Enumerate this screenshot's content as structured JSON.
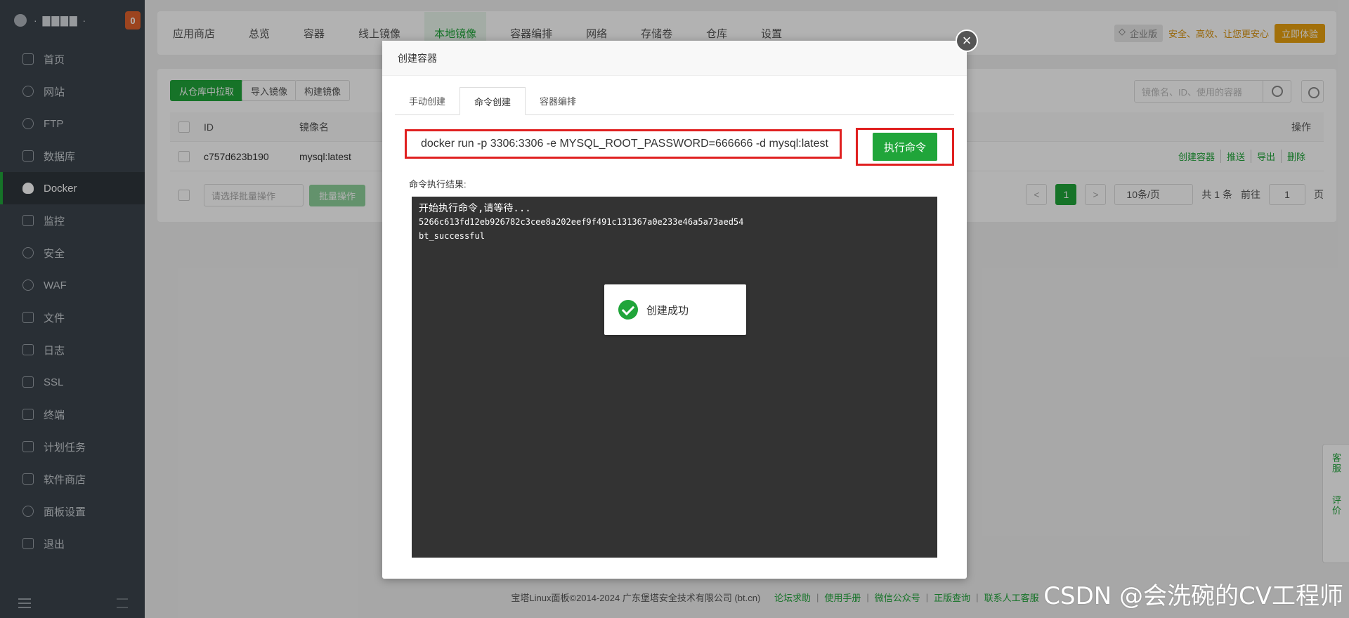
{
  "sidebar": {
    "brand_name": "·  ▇▇▇▇  ·",
    "badge": "0",
    "items": [
      {
        "label": "首页",
        "icon": "home-icon"
      },
      {
        "label": "网站",
        "icon": "globe-icon"
      },
      {
        "label": "FTP",
        "icon": "ftp-icon"
      },
      {
        "label": "数据库",
        "icon": "database-icon"
      },
      {
        "label": "Docker",
        "icon": "docker-icon"
      },
      {
        "label": "监控",
        "icon": "monitor-icon"
      },
      {
        "label": "安全",
        "icon": "shield-icon"
      },
      {
        "label": "WAF",
        "icon": "waf-icon"
      },
      {
        "label": "文件",
        "icon": "folder-icon"
      },
      {
        "label": "日志",
        "icon": "log-icon"
      },
      {
        "label": "SSL",
        "icon": "ssl-icon"
      },
      {
        "label": "终端",
        "icon": "terminal-icon"
      },
      {
        "label": "计划任务",
        "icon": "calendar-icon"
      },
      {
        "label": "软件商店",
        "icon": "apps-icon"
      },
      {
        "label": "面板设置",
        "icon": "gear-icon"
      },
      {
        "label": "退出",
        "icon": "logout-icon"
      }
    ],
    "active_index": 4
  },
  "topbar": {
    "tabs": [
      "应用商店",
      "总览",
      "容器",
      "线上镜像",
      "本地镜像",
      "容器编排",
      "网络",
      "存储卷",
      "仓库",
      "设置"
    ],
    "active_tab": "本地镜像",
    "enterprise_tag": "企业版",
    "slogan": "安全、高效、让您更安心",
    "try_button": "立即体验"
  },
  "toolbar": {
    "pull_button": "从仓库中拉取",
    "import_button": "导入镜像",
    "build_button": "构建镜像",
    "search_placeholder": "镜像名、ID、使用的容器"
  },
  "table": {
    "headers": {
      "id": "ID",
      "name": "镜像名",
      "ops": "操作"
    },
    "rows": [
      {
        "id": "c757d623b190",
        "name": "mysql:latest",
        "ops": [
          "创建容器",
          "推送",
          "导出",
          "删除"
        ]
      }
    ],
    "batch_placeholder": "请选择批量操作",
    "batch_button": "批量操作"
  },
  "pager": {
    "prev": "<",
    "current": "1",
    "next": ">",
    "page_size": "10条/页",
    "total": "共 1 条",
    "goto_prefix": "前往",
    "goto_value": "1",
    "goto_suffix": "页"
  },
  "modal": {
    "title": "创建容器",
    "tabs": [
      "手动创建",
      "命令创建",
      "容器编排"
    ],
    "active_tab": "命令创建",
    "command": "docker run -p 3306:3306 -e MYSQL_ROOT_PASSWORD=666666 -d mysql:latest",
    "exec_button": "执行命令",
    "result_label": "命令执行结果:",
    "console": {
      "line1": "开始执行命令,请等待...",
      "line2": "5266c613fd12eb926782c3cee8a202eef9f491c131367a0e233e46a5a73aed54",
      "line3": "bt_successful"
    }
  },
  "toast": {
    "message": "创建成功"
  },
  "footer": {
    "copyright": "宝塔Linux面板©2014-2024 广东堡塔安全技术有限公司 (bt.cn)",
    "links": [
      "论坛求助",
      "使用手册",
      "微信公众号",
      "正版查询",
      "联系人工客服"
    ]
  },
  "float": {
    "service": "客服",
    "review": "评价"
  },
  "watermark": "CSDN @会洗碗的CV工程师",
  "colors": {
    "accent": "#20a53a",
    "sidebar_bg": "#3c444d",
    "highlight_border": "#e02020",
    "console_bg": "#333333"
  }
}
